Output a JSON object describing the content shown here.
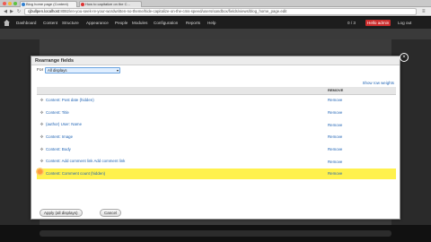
{
  "browser": {
    "tabs": [
      {
        "label": "Blog home page (Content)"
      },
      {
        "label": "How to capitalize on the C..."
      }
    ],
    "url_host": "cjbullpen.localhost",
    "url_path": ":8082/en-you-seek-re-your-wordwritten-no-theme/hide-capitalize-on-the-cms-speed/users/sandbox/fields/views/blog_home_page.edit"
  },
  "toolbar": {
    "items": [
      "Dashboard",
      "Content",
      "Structure",
      "Appearance",
      "People",
      "Modules",
      "Configuration",
      "Reports",
      "Help"
    ],
    "hello": "Hello admin",
    "logout": "Log out",
    "counter": "0 / 3"
  },
  "modal": {
    "title": "Rearrange fields",
    "for_label": "For",
    "for_value": "All displays",
    "show_weights": "Show row weights",
    "table_header": {
      "field": "",
      "remove": "REMOVE"
    },
    "rows": [
      {
        "label": "Content: Post date (hidden)",
        "remove": "Remove",
        "highlight": false
      },
      {
        "label": "Content: Title",
        "remove": "Remove",
        "highlight": false
      },
      {
        "label": "(author) User: Name",
        "remove": "Remove",
        "highlight": false
      },
      {
        "label": "Content: Image",
        "remove": "Remove",
        "highlight": false
      },
      {
        "label": "Content: Body",
        "remove": "Remove",
        "highlight": false
      },
      {
        "label": "Content: Add comment link Add comment link",
        "remove": "Remove",
        "highlight": false
      },
      {
        "label": "Content: Comment count (hidden)",
        "remove": "Remove",
        "highlight": true
      }
    ],
    "apply_button": "Apply (all displays)",
    "cancel_button": "Cancel"
  },
  "colors": {
    "toolbar_bg": "#1d1d1d",
    "user_badge": "#cc2d2d",
    "highlight_row": "#fff14d",
    "link": "#1f63b4"
  }
}
